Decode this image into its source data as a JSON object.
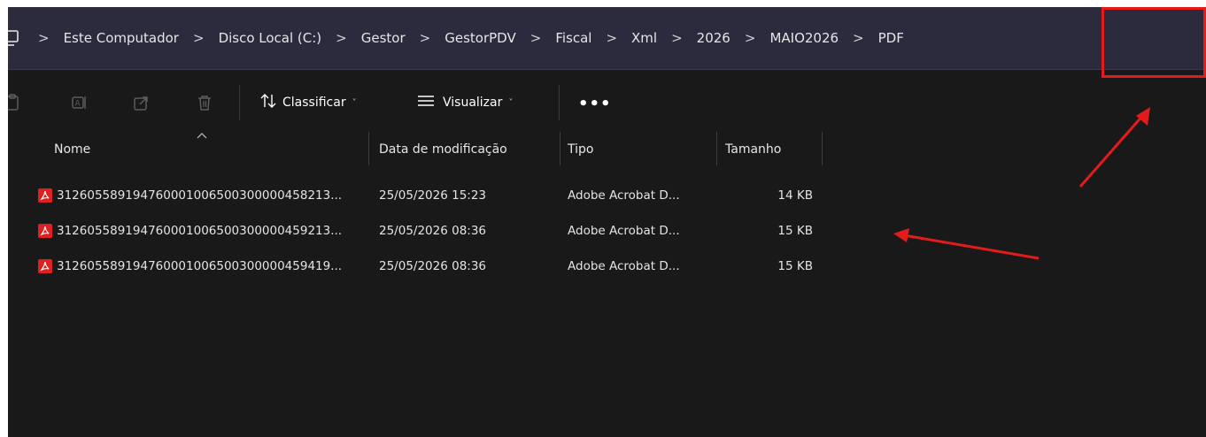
{
  "address": {
    "crumbs": [
      "Este Computador",
      "Disco Local (C:)",
      "Gestor",
      "GestorPDV",
      "Fiscal",
      "Xml",
      "2026",
      "MAIO2026",
      "PDF"
    ],
    "separator": ">"
  },
  "toolbar": {
    "sort_label": "Classificar",
    "view_label": "Visualizar",
    "more_label": "•••",
    "chevron": "˅"
  },
  "columns": {
    "name": "Nome",
    "modified": "Data de modificação",
    "type": "Tipo",
    "size": "Tamanho"
  },
  "files": [
    {
      "name": "312605589194760001006500300000458213...",
      "modified": "25/05/2026 15:23",
      "type": "Adobe Acrobat D...",
      "size": "14 KB"
    },
    {
      "name": "312605589194760001006500300000459213...",
      "modified": "25/05/2026 08:36",
      "type": "Adobe Acrobat D...",
      "size": "15 KB"
    },
    {
      "name": "312605589194760001006500300000459419...",
      "modified": "25/05/2026 08:36",
      "type": "Adobe Acrobat D...",
      "size": "15 KB"
    }
  ],
  "colors": {
    "background": "#191919",
    "address_bar": "#2b2b3d",
    "annotation_red": "#e31b1b",
    "pdf_icon_red": "#e02020"
  }
}
